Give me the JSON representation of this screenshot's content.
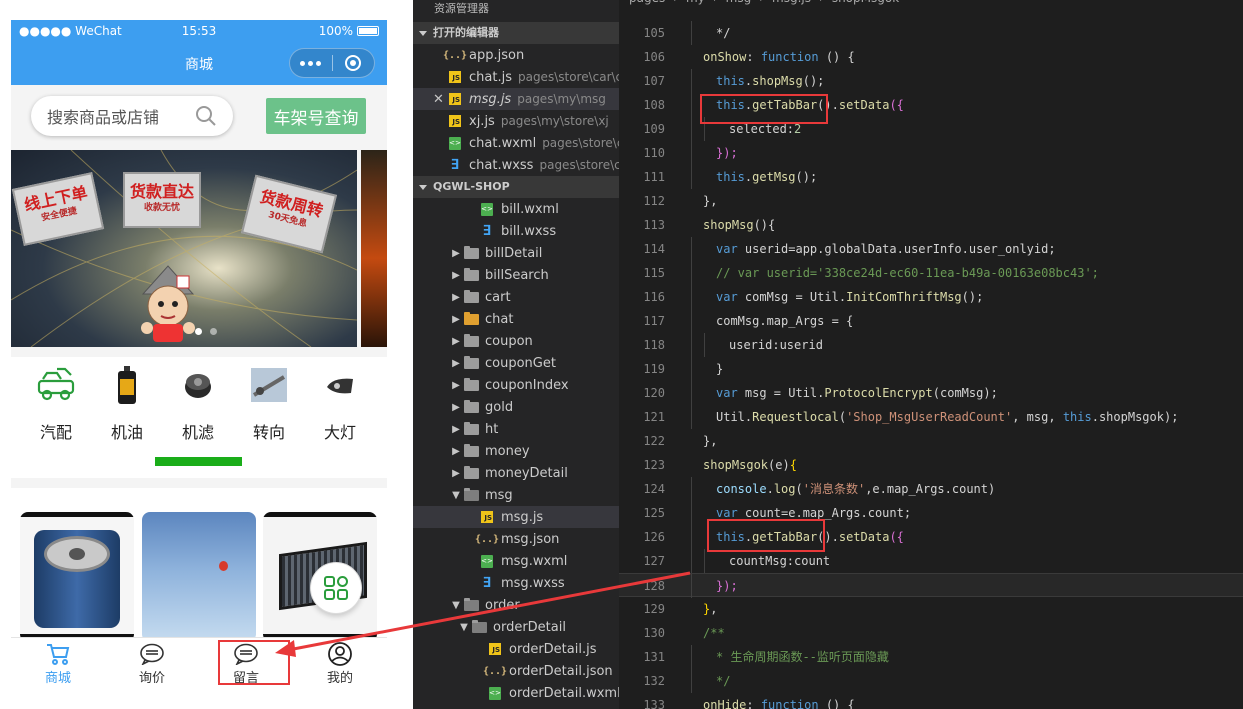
{
  "phone": {
    "status_bar": {
      "carrier": "●●●●● WeChat",
      "time": "15:53",
      "battery": "100%"
    },
    "nav_title": "商城",
    "search": {
      "placeholder": "搜索商品或店铺",
      "plate_button": "车架号查询"
    },
    "banner": {
      "signs": [
        {
          "title": "线上下单",
          "sub": "安全便捷"
        },
        {
          "title": "货款直达",
          "sub": "收款无忧"
        },
        {
          "title": "货款周转",
          "sub": "30天免息"
        }
      ],
      "active_dot": 0,
      "dot_count": 2
    },
    "categories": [
      {
        "label": "汽配",
        "icon": "car-icon"
      },
      {
        "label": "机油",
        "icon": "oil-bottle-icon"
      },
      {
        "label": "机滤",
        "icon": "oil-filter-icon"
      },
      {
        "label": "转向",
        "icon": "steering-part-icon"
      },
      {
        "label": "大灯",
        "icon": "headlight-icon"
      }
    ],
    "products": [
      "oil-filter",
      "sky-photo",
      "cabin-filter"
    ],
    "tabbar": [
      {
        "label": "商城",
        "icon": "cart-icon",
        "active": true
      },
      {
        "label": "询价",
        "icon": "chat-bubble-icon",
        "active": false
      },
      {
        "label": "留言",
        "icon": "chat-bubble-icon",
        "active": false
      },
      {
        "label": "我的",
        "icon": "user-icon",
        "active": false
      }
    ],
    "accent_color": "#3d9ef0",
    "green_color": "#1aad19"
  },
  "explorer": {
    "title": "资源管理器",
    "open_editors_header": "打开的编辑器",
    "open_editors": [
      {
        "name": "app.json",
        "desc": "",
        "type": "json"
      },
      {
        "name": "chat.js",
        "desc": "pages\\store\\car\\ch...",
        "type": "js"
      },
      {
        "name": "msg.js",
        "desc": "pages\\my\\msg",
        "type": "js",
        "active": true
      },
      {
        "name": "xj.js",
        "desc": "pages\\my\\store\\xj",
        "type": "js"
      },
      {
        "name": "chat.wxml",
        "desc": "pages\\store\\c...",
        "type": "wxml"
      },
      {
        "name": "chat.wxss",
        "desc": "pages\\store\\ca...",
        "type": "wxss"
      }
    ],
    "project_header": "QGWL-SHOP",
    "tree": [
      {
        "name": "bill.wxml",
        "type": "wxml",
        "depth": 2
      },
      {
        "name": "bill.wxss",
        "type": "wxss",
        "depth": 2
      },
      {
        "name": "billDetail",
        "type": "folder",
        "depth": 1
      },
      {
        "name": "billSearch",
        "type": "folder",
        "depth": 1
      },
      {
        "name": "cart",
        "type": "folder",
        "depth": 1
      },
      {
        "name": "chat",
        "type": "folder-orange",
        "depth": 1
      },
      {
        "name": "coupon",
        "type": "folder",
        "depth": 1
      },
      {
        "name": "couponGet",
        "type": "folder",
        "depth": 1
      },
      {
        "name": "couponIndex",
        "type": "folder",
        "depth": 1
      },
      {
        "name": "gold",
        "type": "folder",
        "depth": 1
      },
      {
        "name": "ht",
        "type": "folder",
        "depth": 1
      },
      {
        "name": "money",
        "type": "folder",
        "depth": 1
      },
      {
        "name": "moneyDetail",
        "type": "folder",
        "depth": 1
      },
      {
        "name": "msg",
        "type": "folder-open",
        "depth": 1
      },
      {
        "name": "msg.js",
        "type": "js",
        "depth": 2,
        "selected": true
      },
      {
        "name": "msg.json",
        "type": "json",
        "depth": 2
      },
      {
        "name": "msg.wxml",
        "type": "wxml",
        "depth": 2
      },
      {
        "name": "msg.wxss",
        "type": "wxss",
        "depth": 2
      },
      {
        "name": "order",
        "type": "folder-open",
        "depth": 1
      },
      {
        "name": "orderDetail",
        "type": "folder-open",
        "depth": 2
      },
      {
        "name": "orderDetail.js",
        "type": "js",
        "depth": 3
      },
      {
        "name": "orderDetail.json",
        "type": "json",
        "depth": 3
      },
      {
        "name": "orderDetail.wxml",
        "type": "wxml",
        "depth": 3
      }
    ]
  },
  "editor": {
    "breadcrumb": [
      "pages",
      "my",
      "msg",
      "msg.js",
      "shopMsgok"
    ],
    "current_line": 128,
    "lines": [
      {
        "n": 105,
        "indent": 1,
        "tokens": [
          [
            "p",
            "*/"
          ]
        ]
      },
      {
        "n": 106,
        "indent": 0,
        "tokens": [
          [
            "fn",
            "onShow"
          ],
          [
            "p",
            ": "
          ],
          [
            "kw",
            "function"
          ],
          [
            "p",
            " () {"
          ]
        ]
      },
      {
        "n": 107,
        "indent": 1,
        "tokens": [
          [
            "kw",
            "this"
          ],
          [
            "p",
            "."
          ],
          [
            "fn",
            "shopMsg"
          ],
          [
            "p",
            "();"
          ]
        ]
      },
      {
        "n": 108,
        "indent": 1,
        "tokens": [
          [
            "kw",
            "this"
          ],
          [
            "p",
            "."
          ],
          [
            "fn",
            "getTabBar"
          ],
          [
            "p",
            "()."
          ],
          [
            "fn",
            "setData"
          ],
          [
            "pur",
            "({"
          ]
        ]
      },
      {
        "n": 109,
        "indent": 2,
        "tokens": [
          [
            "p",
            "selected:"
          ],
          [
            "num",
            "2"
          ]
        ]
      },
      {
        "n": 110,
        "indent": 1,
        "tokens": [
          [
            "pur",
            "});"
          ]
        ]
      },
      {
        "n": 111,
        "indent": 1,
        "tokens": [
          [
            "kw",
            "this"
          ],
          [
            "p",
            "."
          ],
          [
            "fn",
            "getMsg"
          ],
          [
            "p",
            "();"
          ]
        ]
      },
      {
        "n": 112,
        "indent": 0,
        "tokens": [
          [
            "p",
            "},"
          ]
        ]
      },
      {
        "n": 113,
        "indent": 0,
        "tokens": [
          [
            "fn",
            "shopMsg"
          ],
          [
            "p",
            "(){"
          ]
        ]
      },
      {
        "n": 114,
        "indent": 1,
        "tokens": [
          [
            "kw",
            "var"
          ],
          [
            "p",
            " userid=app.globalData.userInfo.user_onlyid;"
          ]
        ]
      },
      {
        "n": 115,
        "indent": 1,
        "tokens": [
          [
            "cmt",
            "// var userid='338ce24d-ec60-11ea-b49a-00163e08bc43';"
          ]
        ]
      },
      {
        "n": 116,
        "indent": 1,
        "tokens": [
          [
            "kw",
            "var"
          ],
          [
            "p",
            " comMsg = Util."
          ],
          [
            "fn",
            "InitComThriftMsg"
          ],
          [
            "p",
            "();"
          ]
        ]
      },
      {
        "n": 117,
        "indent": 1,
        "tokens": [
          [
            "p",
            "comMsg.map_Args = {"
          ]
        ]
      },
      {
        "n": 118,
        "indent": 2,
        "tokens": [
          [
            "p",
            "userid:userid"
          ]
        ]
      },
      {
        "n": 119,
        "indent": 1,
        "tokens": [
          [
            "p",
            "}"
          ]
        ]
      },
      {
        "n": 120,
        "indent": 1,
        "tokens": [
          [
            "kw",
            "var"
          ],
          [
            "p",
            " msg = Util."
          ],
          [
            "fn",
            "ProtocolEncrypt"
          ],
          [
            "p",
            "(comMsg);"
          ]
        ]
      },
      {
        "n": 121,
        "indent": 1,
        "tokens": [
          [
            "p",
            "Util."
          ],
          [
            "fn",
            "Requestlocal"
          ],
          [
            "p",
            "("
          ],
          [
            "str",
            "'Shop_MsgUserReadCount'"
          ],
          [
            "p",
            ", msg, "
          ],
          [
            "kw",
            "this"
          ],
          [
            "p",
            ".shopMsgok);"
          ]
        ]
      },
      {
        "n": 122,
        "indent": 0,
        "tokens": [
          [
            "p",
            "},"
          ]
        ]
      },
      {
        "n": 123,
        "indent": 0,
        "tokens": [
          [
            "fn",
            "shopMsgok"
          ],
          [
            "p",
            "(e)"
          ],
          [
            "punc",
            "{"
          ]
        ]
      },
      {
        "n": 124,
        "indent": 1,
        "tokens": [
          [
            "prop",
            "console"
          ],
          [
            "p",
            "."
          ],
          [
            "fn",
            "log"
          ],
          [
            "p",
            "("
          ],
          [
            "str",
            "'消息条数'"
          ],
          [
            "p",
            ",e.map_Args.count)"
          ]
        ]
      },
      {
        "n": 125,
        "indent": 1,
        "tokens": [
          [
            "kw",
            "var"
          ],
          [
            "p",
            " count=e.map_Args.count;"
          ]
        ]
      },
      {
        "n": 126,
        "indent": 1,
        "tokens": [
          [
            "kw",
            "this"
          ],
          [
            "p",
            "."
          ],
          [
            "fn",
            "getTabBar"
          ],
          [
            "p",
            "()."
          ],
          [
            "fn",
            "setData"
          ],
          [
            "pur",
            "({"
          ]
        ]
      },
      {
        "n": 127,
        "indent": 2,
        "tokens": [
          [
            "p",
            "countMsg:count"
          ]
        ]
      },
      {
        "n": 128,
        "indent": 1,
        "tokens": [
          [
            "pur",
            "});"
          ]
        ]
      },
      {
        "n": 129,
        "indent": 0,
        "tokens": [
          [
            "punc",
            "}"
          ],
          [
            "p",
            ","
          ]
        ]
      },
      {
        "n": 130,
        "indent": 0,
        "tokens": [
          [
            "cmt",
            "/**"
          ]
        ]
      },
      {
        "n": 131,
        "indent": 1,
        "tokens": [
          [
            "cmt",
            "* 生命周期函数--监听页面隐藏"
          ]
        ]
      },
      {
        "n": 132,
        "indent": 1,
        "tokens": [
          [
            "cmt",
            "*/"
          ]
        ]
      },
      {
        "n": 133,
        "indent": 0,
        "tokens": [
          [
            "fn",
            "onHide"
          ],
          [
            "p",
            ": "
          ],
          [
            "kw",
            "function"
          ],
          [
            "p",
            " () {"
          ]
        ]
      }
    ]
  },
  "annotation_color": "#e8393a"
}
